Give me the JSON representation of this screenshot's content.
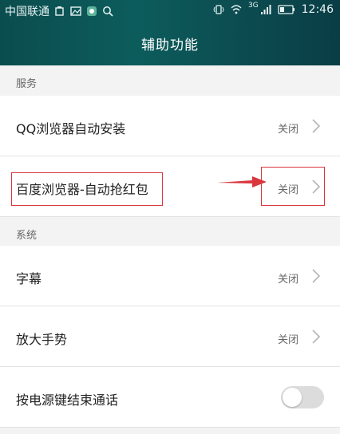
{
  "status_bar": {
    "carrier": "中国联通",
    "network": "3G",
    "time": "12:46"
  },
  "header": {
    "title": "辅助功能"
  },
  "sections": [
    {
      "header": "服务",
      "items": [
        {
          "label": "QQ浏览器自动安装",
          "value": "关闭"
        },
        {
          "label": "百度浏览器-自动抢红包",
          "value": "关闭"
        }
      ]
    },
    {
      "header": "系统",
      "items": [
        {
          "label": "字幕",
          "value": "关闭"
        },
        {
          "label": "放大手势",
          "value": "关闭"
        },
        {
          "label": "按电源键结束通话",
          "toggle": false
        }
      ]
    }
  ],
  "colors": {
    "header_bg": "#0b4d4f",
    "annotation": "#d9363e"
  }
}
